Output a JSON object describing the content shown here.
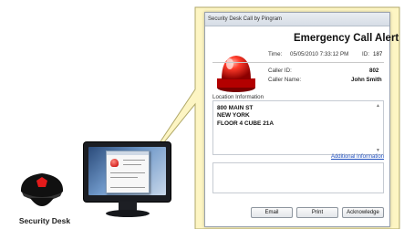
{
  "window": {
    "title": "Security Desk Call by Pingram",
    "heading": "Emergency Call Alert"
  },
  "call": {
    "time_label": "Time:",
    "time_value": "05/05/2010 7:33:12 PM",
    "id_label": "ID:",
    "id_value": "187",
    "caller_id_label": "Caller ID:",
    "caller_id_value": "802",
    "caller_name_label": "Caller Name:",
    "caller_name_value": "John Smith"
  },
  "location": {
    "label": "Location Information",
    "line1": "800  MAIN ST",
    "line2": "NEW YORK",
    "line3": "FLOOR 4 CUBE 21A",
    "additional_link": "Additional Information"
  },
  "notes_value": "",
  "buttons": {
    "email": "Email",
    "print": "Print",
    "acknowledge": "Acknowledge"
  },
  "guard_label": "Security Desk",
  "colors": {
    "callout_fill": "#fdf5c3",
    "callout_stroke": "#b0a868",
    "siren_red": "#d00000",
    "link_blue": "#1f4fbf"
  },
  "icons": [
    "siren-icon",
    "security-guard-icon",
    "computer-monitor-icon"
  ]
}
